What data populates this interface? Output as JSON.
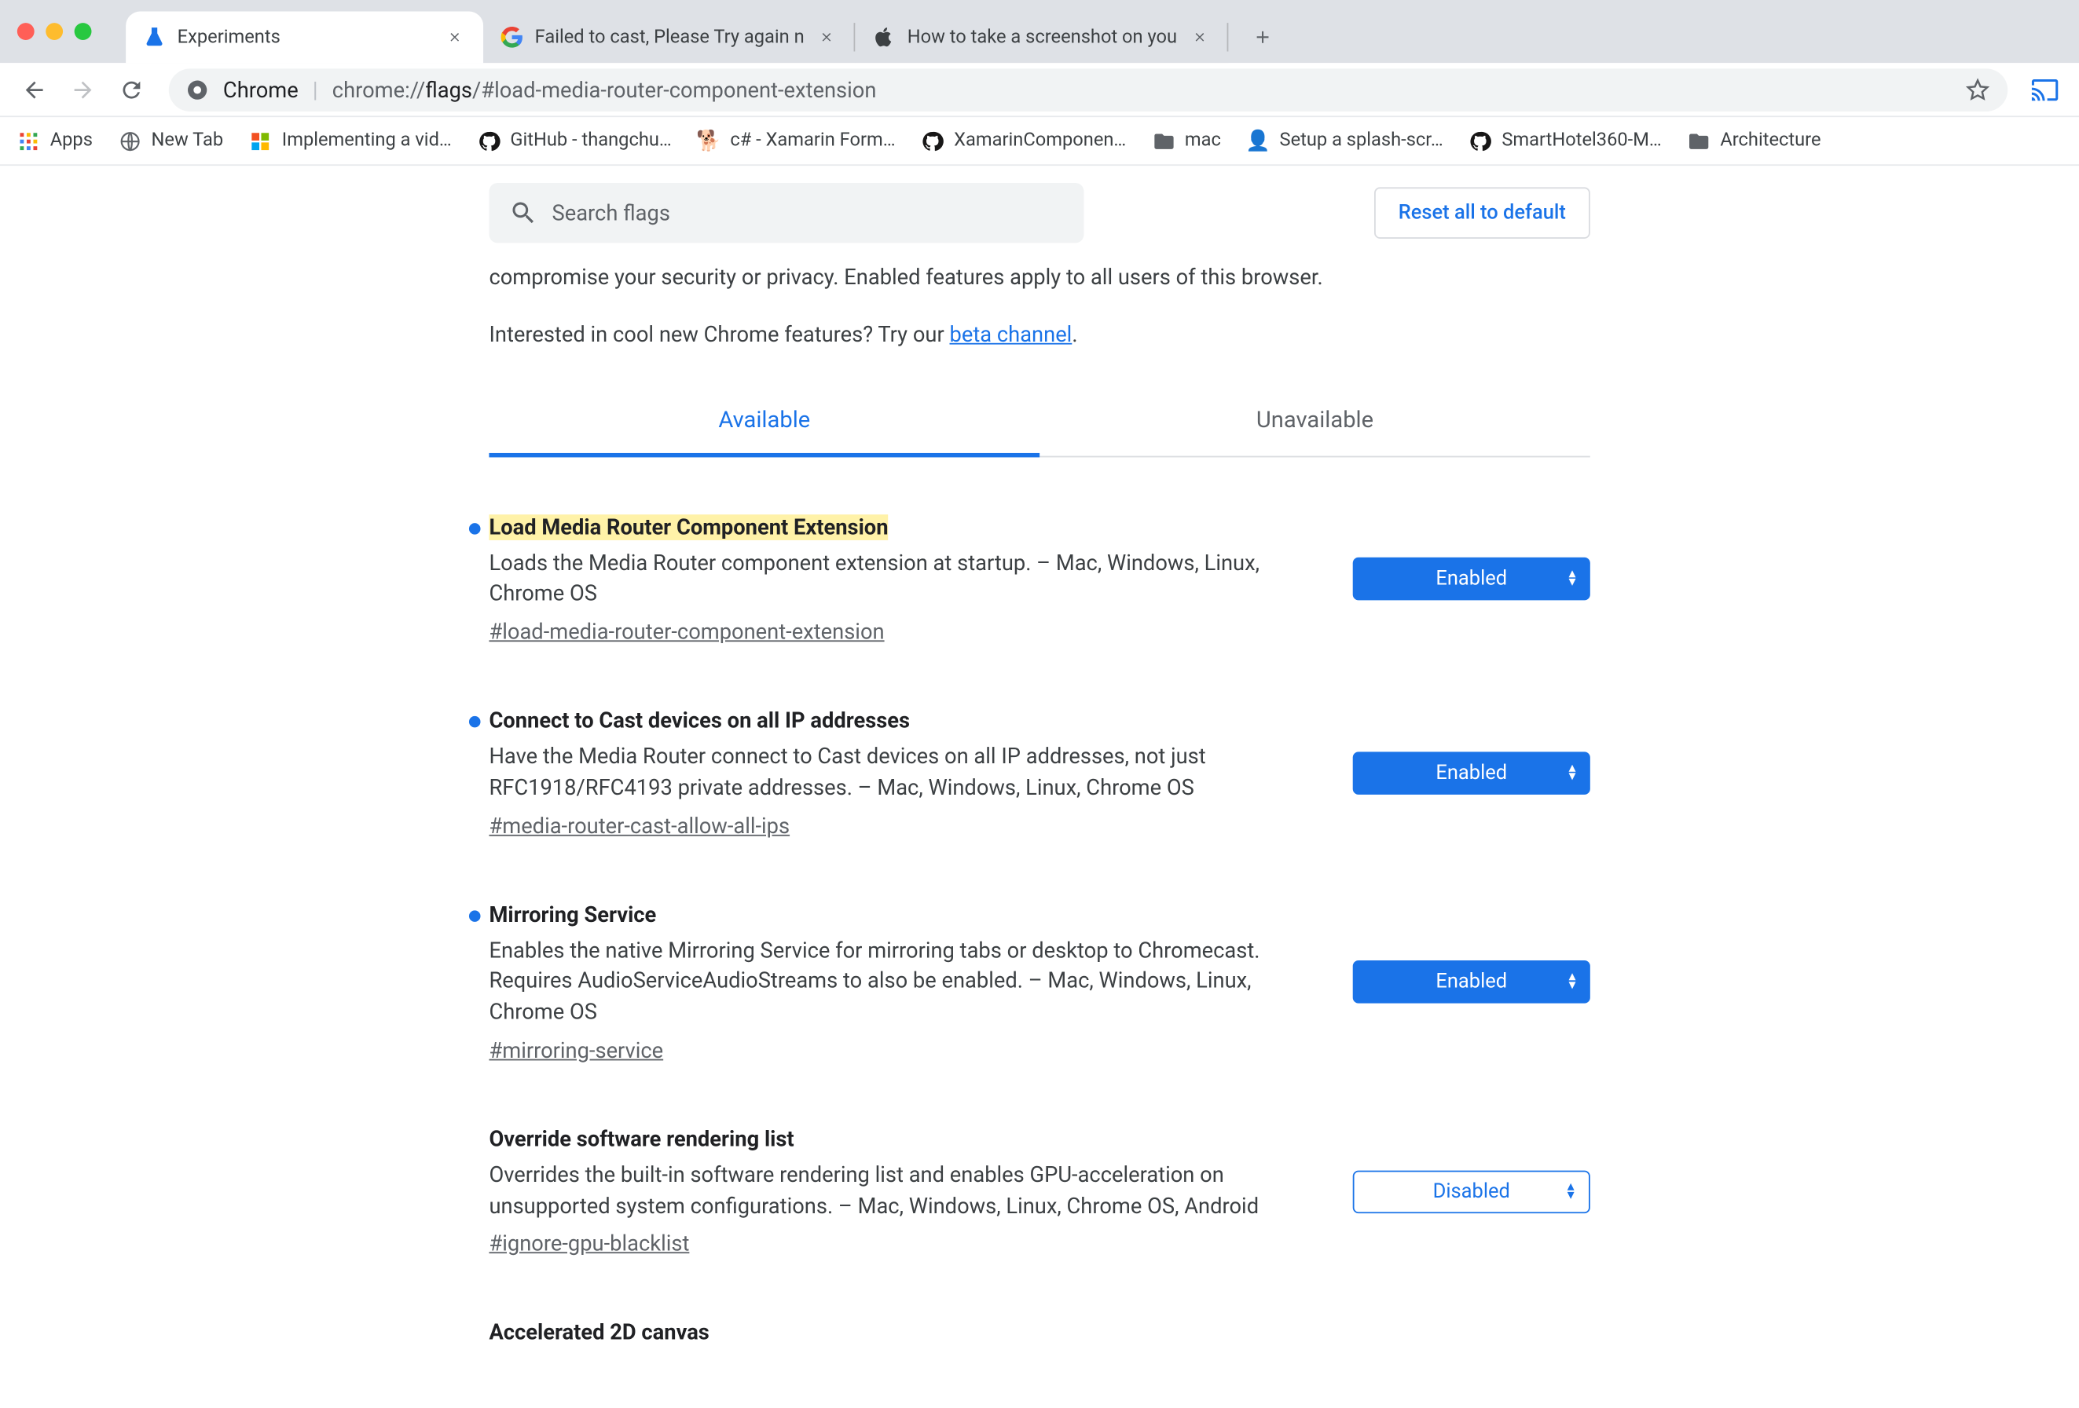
{
  "tabs": [
    {
      "title": "Experiments",
      "icon": "flask",
      "active": true
    },
    {
      "title": "Failed to cast, Please Try again n",
      "icon": "google",
      "active": false
    },
    {
      "title": "How to take a screenshot on you",
      "icon": "apple",
      "active": false
    }
  ],
  "omnibox": {
    "prefix": "Chrome",
    "url_plain": "chrome://",
    "url_bold": "flags",
    "url_rest": "/#load-media-router-component-extension"
  },
  "bookmarks": [
    {
      "label": "Apps",
      "icon": "apps"
    },
    {
      "label": "New Tab",
      "icon": "globe"
    },
    {
      "label": "Implementing a vid…",
      "icon": "ms"
    },
    {
      "label": "GitHub - thangchu…",
      "icon": "gh"
    },
    {
      "label": "c# - Xamarin Form…",
      "icon": "xam"
    },
    {
      "label": "XamarinComponen…",
      "icon": "gh"
    },
    {
      "label": "mac",
      "icon": "folder"
    },
    {
      "label": "Setup a splash-scr…",
      "icon": "avatar"
    },
    {
      "label": "SmartHotel360-M…",
      "icon": "gh"
    },
    {
      "label": "Architecture",
      "icon": "folder"
    }
  ],
  "search": {
    "placeholder": "Search flags"
  },
  "reset_label": "Reset all to default",
  "warning_text": "compromise your security or privacy. Enabled features apply to all users of this browser.",
  "beta_prefix": "Interested in cool new Chrome features? Try our ",
  "beta_link": "beta channel",
  "page_tabs": {
    "available": "Available",
    "unavailable": "Unavailable"
  },
  "select_values": {
    "enabled": "Enabled",
    "disabled": "Disabled"
  },
  "flags": [
    {
      "title": "Load Media Router Component Extension",
      "highlight": true,
      "dot": true,
      "desc": "Loads the Media Router component extension at startup. – Mac, Windows, Linux, Chrome OS",
      "anchor": "#load-media-router-component-extension",
      "state": "enabled"
    },
    {
      "title": "Connect to Cast devices on all IP addresses",
      "highlight": false,
      "dot": true,
      "desc": "Have the Media Router connect to Cast devices on all IP addresses, not just RFC1918/RFC4193 private addresses. – Mac, Windows, Linux, Chrome OS",
      "anchor": "#media-router-cast-allow-all-ips",
      "state": "enabled"
    },
    {
      "title": "Mirroring Service",
      "highlight": false,
      "dot": true,
      "desc": "Enables the native Mirroring Service for mirroring tabs or desktop to Chromecast. Requires AudioServiceAudioStreams to also be enabled. – Mac, Windows, Linux, Chrome OS",
      "anchor": "#mirroring-service",
      "state": "enabled"
    },
    {
      "title": "Override software rendering list",
      "highlight": false,
      "dot": false,
      "desc": "Overrides the built-in software rendering list and enables GPU-acceleration on unsupported system configurations. – Mac, Windows, Linux, Chrome OS, Android",
      "anchor": "#ignore-gpu-blacklist",
      "state": "disabled"
    },
    {
      "title": "Accelerated 2D canvas",
      "highlight": false,
      "dot": false,
      "desc": "",
      "anchor": "",
      "state": ""
    }
  ]
}
